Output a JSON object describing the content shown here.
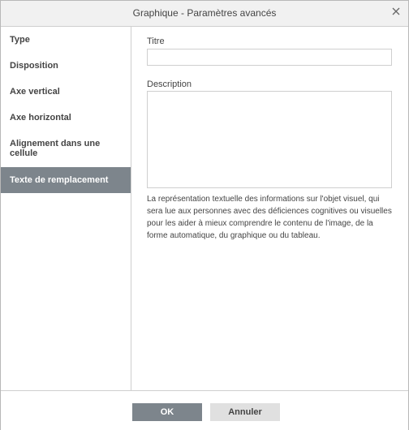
{
  "dialog": {
    "title": "Graphique - Paramètres avancés"
  },
  "sidebar": {
    "items": [
      {
        "label": "Type"
      },
      {
        "label": "Disposition"
      },
      {
        "label": "Axe vertical"
      },
      {
        "label": "Axe horizontal"
      },
      {
        "label": "Alignement dans une cellule"
      },
      {
        "label": "Texte de remplacement",
        "active": true
      }
    ]
  },
  "form": {
    "title_label": "Titre",
    "title_value": "",
    "description_label": "Description",
    "description_value": "",
    "help_text": "La représentation textuelle des informations sur l'objet visuel, qui sera lue aux personnes avec des déficiences cognitives ou visuelles pour les aider à mieux comprendre le contenu de l'image, de la forme automatique, du graphique ou du tableau."
  },
  "footer": {
    "ok_label": "OK",
    "cancel_label": "Annuler"
  },
  "colors": {
    "active_bg": "#7d858c",
    "titlebar_bg": "#f1f1f1",
    "cancel_bg": "#e0e0e0"
  },
  "icons": {
    "close": "close-icon"
  }
}
